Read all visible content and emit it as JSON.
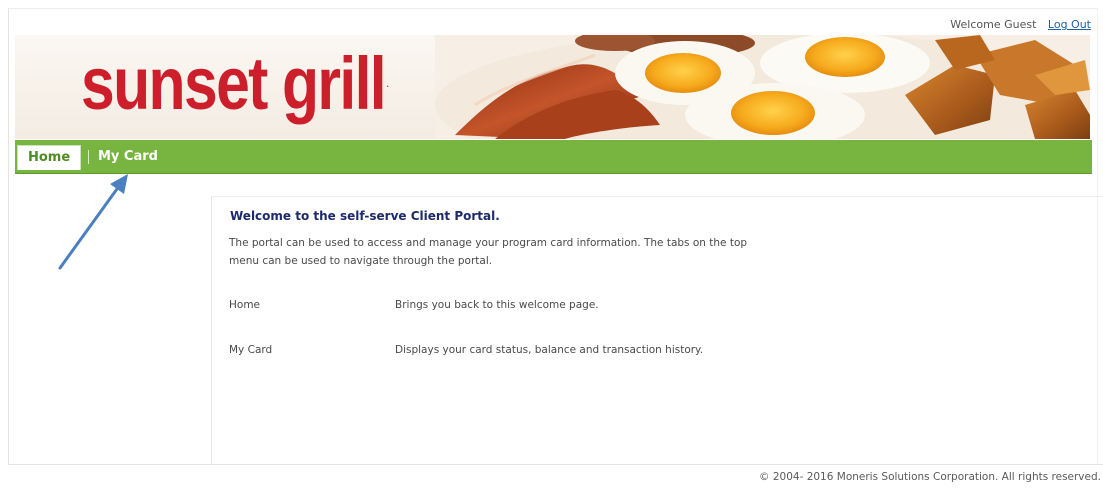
{
  "header": {
    "welcome_text": "Welcome Guest",
    "logout_label": "Log Out"
  },
  "banner": {
    "logo_text": "sunset grill",
    "logo_color": "#cc1f2b"
  },
  "nav": {
    "tabs": [
      {
        "label": "Home",
        "active": true
      },
      {
        "label": "My Card",
        "active": false
      }
    ],
    "bar_color": "#78b440"
  },
  "main": {
    "title": "Welcome to the self-serve Client Portal.",
    "intro_line1": "The portal can be used to access and manage your program card information. The tabs on the top",
    "intro_line2": "menu can be used to navigate through the portal.",
    "rows": [
      {
        "label": "Home",
        "description": "Brings you back to this welcome page."
      },
      {
        "label": "My Card",
        "description": "Displays your card status, balance and transaction history."
      }
    ]
  },
  "annotation": {
    "arrow_color": "#4a7fc1"
  },
  "footer": {
    "copyright": "© 2004- 2016  Moneris Solutions Corporation. All rights reserved."
  }
}
